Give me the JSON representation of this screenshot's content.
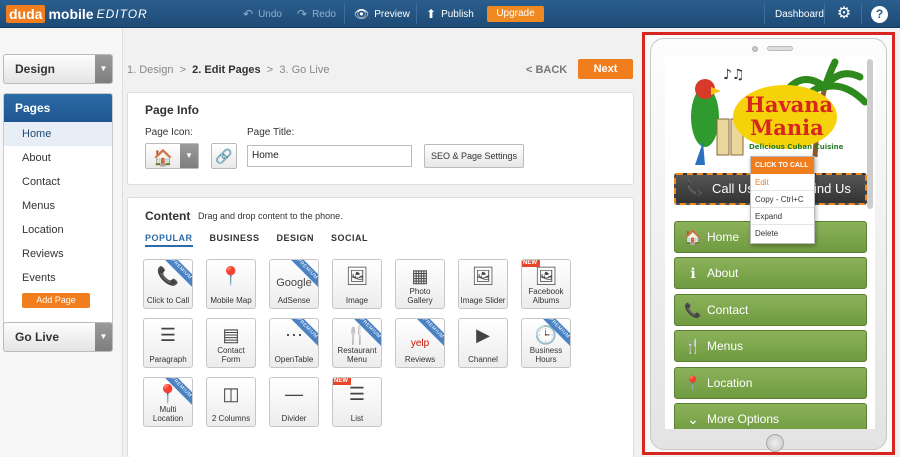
{
  "topbar": {
    "logo_duda": "duda",
    "logo_mobile": "mobile",
    "logo_editor": "EDITOR",
    "undo": "Undo",
    "redo": "Redo",
    "preview": "Preview",
    "publish": "Publish",
    "upgrade": "Upgrade",
    "dashboard": "Dashboard"
  },
  "sidebar": {
    "design": "Design",
    "pages_title": "Pages",
    "pages": [
      "Home",
      "About",
      "Contact",
      "Menus",
      "Location",
      "Reviews",
      "Events"
    ],
    "add_page": "Add Page",
    "go_live": "Go Live"
  },
  "steps": {
    "step1": "1. Design",
    "sep1": ">",
    "step2": "2. Edit Pages",
    "sep2": ">",
    "step3": "3. Go Live",
    "back": "< BACK",
    "next": "Next"
  },
  "page_info": {
    "title": "Page Info",
    "icon_label": "Page Icon:",
    "title_label": "Page Title:",
    "title_value": "Home",
    "seo_button": "SEO & Page Settings"
  },
  "content": {
    "title": "Content",
    "hint": "Drag and drop content to the phone.",
    "tabs": [
      "POPULAR",
      "BUSINESS",
      "DESIGN",
      "SOCIAL"
    ],
    "widgets": [
      {
        "label": "Click to Call",
        "badge": "PREMIUM"
      },
      {
        "label": "Mobile Map",
        "badge": ""
      },
      {
        "label": "AdSense",
        "badge": "PREMIUM"
      },
      {
        "label": "Image",
        "badge": ""
      },
      {
        "label": "Photo Gallery",
        "badge": ""
      },
      {
        "label": "Image Slider",
        "badge": ""
      },
      {
        "label": "Facebook Albums",
        "badge": "NEW"
      },
      {
        "label": "Paragraph",
        "badge": ""
      },
      {
        "label": "Contact Form",
        "badge": ""
      },
      {
        "label": "OpenTable",
        "badge": "PREMIUM"
      },
      {
        "label": "Restaurant Menu",
        "badge": "PREMIUM"
      },
      {
        "label": "Reviews",
        "badge": "PREMIUM"
      },
      {
        "label": "Channel",
        "badge": ""
      },
      {
        "label": "Business Hours",
        "badge": "PREMIUM"
      },
      {
        "label": "Multi Location",
        "badge": "PREMIUM"
      },
      {
        "label": "2 Columns",
        "badge": ""
      },
      {
        "label": "Divider",
        "badge": ""
      },
      {
        "label": "List",
        "badge": "NEW"
      }
    ],
    "widget_glyphs": {
      "adsense": "Google",
      "reviews": "yelp"
    }
  },
  "phone": {
    "logo_line1": "Havana",
    "logo_line2": "Mania",
    "logo_tagline": "Delicious Cuban Cuisine",
    "call_us": "Call Us",
    "find_us": "ind Us",
    "menu": [
      "Home",
      "About",
      "Contact",
      "Menus",
      "Location",
      "More Options"
    ]
  },
  "context_menu": {
    "header": "CLICK TO CALL",
    "items": [
      "Edit",
      "Copy - Ctrl+C",
      "Expand",
      "Delete"
    ]
  },
  "colors": {
    "accent": "#f07d1e",
    "brand_blue": "#1e4b76",
    "menu_green": "#7ca64c",
    "highlight_red": "#d8261f"
  }
}
